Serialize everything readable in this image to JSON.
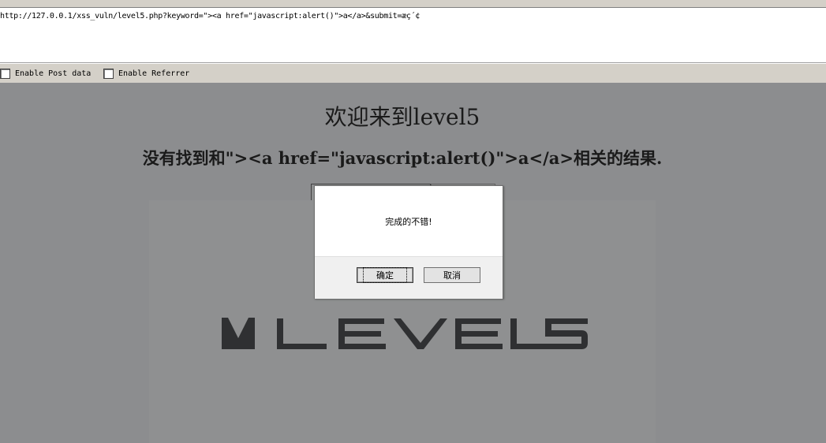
{
  "browser": {
    "url": "http://127.0.0.1/xss_vuln/level5.php?keyword=\"><a href=\"javascript:alert()\">a</a>&submit=æç´¢",
    "options": {
      "post_label": "Enable Post data",
      "referrer_label": "Enable Referrer"
    }
  },
  "page": {
    "title": "欢迎来到level5",
    "result": "没有找到和\"><a href=\"javascript:alert()\">a</a>相关的结果.",
    "logo_text": "LEVEL5"
  },
  "dialog": {
    "message": "完成的不错!",
    "ok_label": "确定",
    "cancel_label": "取消"
  },
  "colors": {
    "overlay": "#8c8d8f",
    "toolbar": "#d4d0c8",
    "logo": "#2f3032"
  }
}
